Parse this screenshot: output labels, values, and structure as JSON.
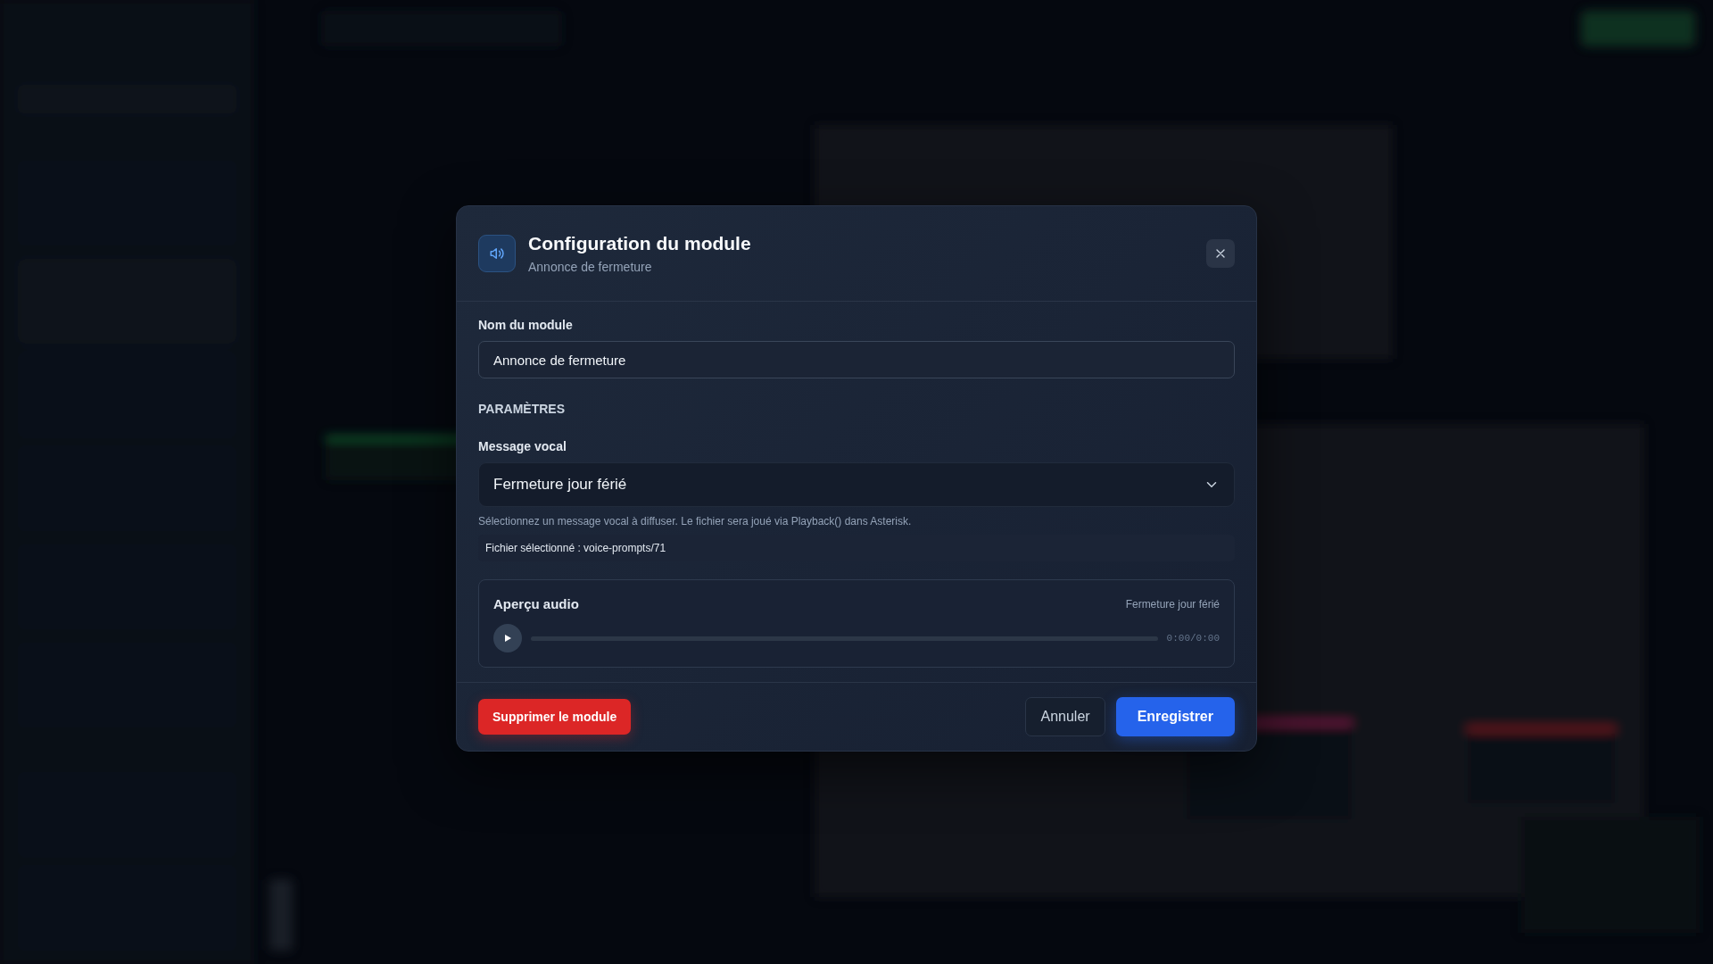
{
  "dialog": {
    "title": "Configuration du module",
    "subtitle": "Annonce de fermeture",
    "name_field": {
      "label": "Nom du module",
      "value": "Annonce de fermeture"
    },
    "section": "PARAMÈTRES",
    "voice_select": {
      "label": "Message vocal",
      "value": "Fermeture jour férié",
      "help": "Sélectionnez un message vocal à diffuser. Le fichier sera joué via Playback() dans Asterisk.",
      "selected_file": "Fichier sélectionné : voice-prompts/71"
    },
    "audio_preview": {
      "title": "Aperçu audio",
      "track": "Fermeture jour férié",
      "level": 0,
      "time": "0:00/0:00"
    },
    "buttons": {
      "delete": "Supprimer le module",
      "cancel": "Annuler",
      "save": "Enregistrer"
    }
  }
}
